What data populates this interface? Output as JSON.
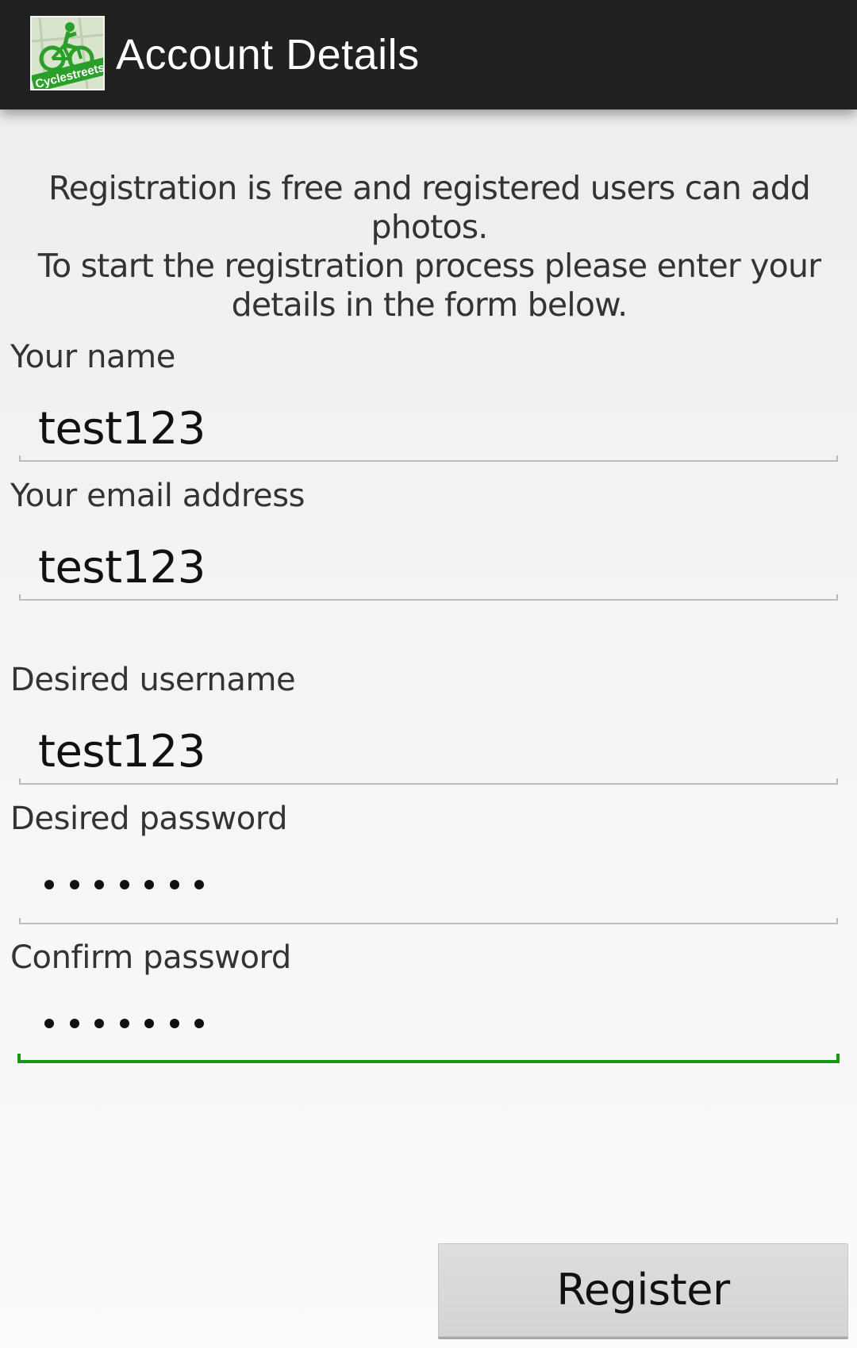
{
  "header": {
    "app_icon": "cyclestreets-logo",
    "logo_text": "Cyclestreets",
    "title": "Account Details"
  },
  "intro": {
    "line1": "Registration is free and registered users can add photos.",
    "line2": "To start the registration process please enter your",
    "line3": "details in the form below."
  },
  "form": {
    "name": {
      "label": "Your name",
      "value": "test123"
    },
    "email": {
      "label": "Your email address",
      "value": "test123"
    },
    "username": {
      "label": "Desired username",
      "value": "test123"
    },
    "password": {
      "label": "Desired password",
      "masked_length": 7
    },
    "confirm_password": {
      "label": "Confirm password",
      "masked_length": 7
    }
  },
  "register_button": {
    "label": "Register"
  },
  "colors": {
    "action_bar": "#212121",
    "focus_accent": "#129a12",
    "logo_green": "#2aa02a"
  }
}
